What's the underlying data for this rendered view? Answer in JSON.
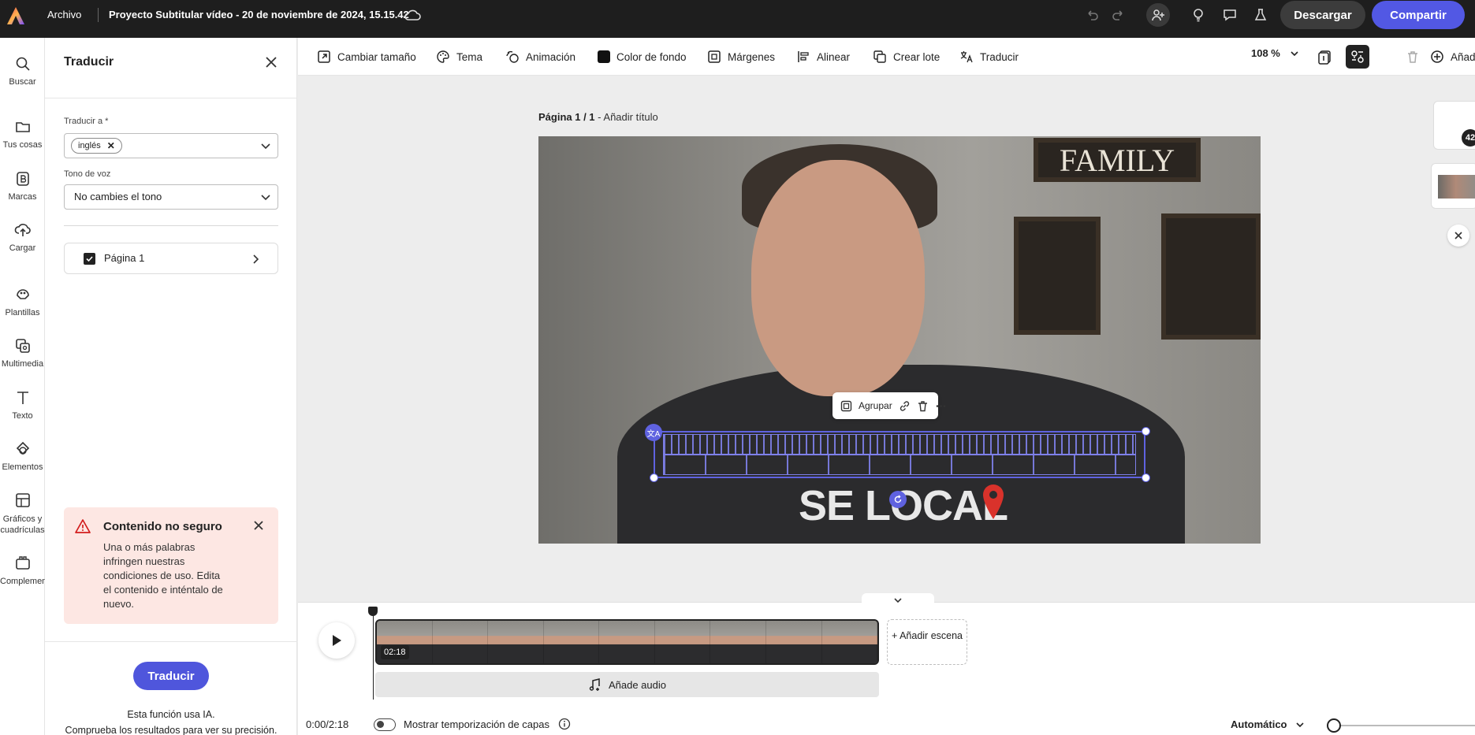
{
  "topbar": {
    "file_menu": "Archivo",
    "project_title": "Proyecto Subtitular vídeo - 20 de noviembre de 2024, 15.15.42",
    "download_label": "Descargar",
    "share_label": "Compartir",
    "icons": [
      "adobe-express-logo",
      "cloud-icon",
      "undo-icon",
      "redo-icon",
      "invite-icon",
      "lightbulb-icon",
      "comment-icon",
      "lab-icon"
    ]
  },
  "rail": {
    "items": [
      {
        "label": "Buscar",
        "icon": "search-icon"
      },
      {
        "label": "Tus cosas",
        "icon": "folder-icon"
      },
      {
        "label": "Marcas",
        "icon": "brand-icon"
      },
      {
        "label": "Cargar",
        "icon": "upload-icon"
      },
      {
        "label": "Plantillas",
        "icon": "templates-icon"
      },
      {
        "label": "Multimedia",
        "icon": "media-icon"
      },
      {
        "label": "Texto",
        "icon": "text-icon"
      },
      {
        "label": "Elementos",
        "icon": "elements-icon"
      },
      {
        "label": "Gráficos y cuadrículas",
        "icon": "charts-icon"
      },
      {
        "label": "Complementos",
        "icon": "addons-icon"
      }
    ]
  },
  "panel": {
    "title": "Traducir",
    "translate_to_label": "Traducir a *",
    "translate_to_chip": "inglés",
    "tone_label": "Tono de voz",
    "tone_value": "No cambies el tono",
    "page_item": "Página 1",
    "page_checked": true,
    "alert": {
      "title": "Contenido no seguro",
      "body": "Una o más palabras infringen nuestras condiciones de uso. Edita el contenido e inténtalo de nuevo."
    },
    "translate_button": "Traducir",
    "ai_note_line1": "Esta función usa IA.",
    "ai_note_line2": "Comprueba los resultados para ver su precisión."
  },
  "toolbar": {
    "resize": "Cambiar tamaño",
    "theme": "Tema",
    "animation": "Animación",
    "background_color": "Color de fondo",
    "background_color_value": "#111111",
    "margins": "Márgenes",
    "align": "Alinear",
    "batch": "Crear lote",
    "translate": "Traducir",
    "zoom": "108 %",
    "add": "Añadi"
  },
  "canvas": {
    "page_label_bold": "Página 1 / 1",
    "page_label_rest": "- Añadir título",
    "video_sign": "FAMILY",
    "shirt_text": "SE LOCAL",
    "floating_group": "Agrupar",
    "thumb_badge": "42"
  },
  "timeline": {
    "clip_duration": "02:18",
    "clip_frames": 9,
    "add_scene": "+ Añadir escena",
    "add_audio": "Añade audio",
    "time": "0:00/2:18",
    "layer_timing_label": "Mostrar temporización de capas",
    "layer_timing_on": false,
    "playback_mode": "Automático"
  },
  "colors": {
    "accent": "#5258e4",
    "alert_bg": "#fde7e3",
    "alert_icon": "#d21d1d",
    "topbar": "#1e1e1e"
  }
}
